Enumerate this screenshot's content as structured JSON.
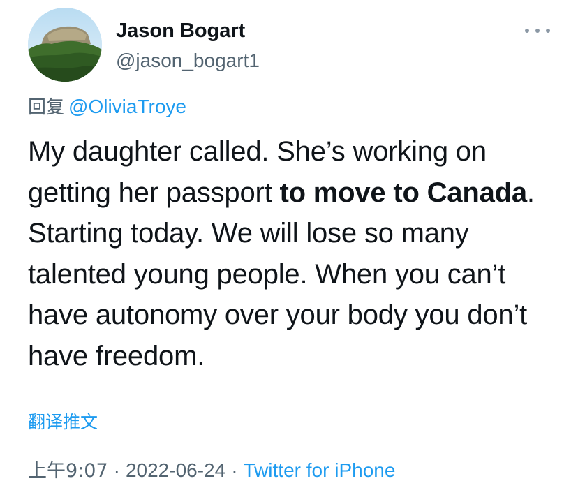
{
  "author": {
    "display_name": "Jason Bogart",
    "handle": "@jason_bogart1"
  },
  "reply": {
    "prefix": "回复",
    "mention": "@OliviaTroye"
  },
  "tweet": {
    "text_part1": "My daughter called. She’s working on getting her passport ",
    "text_bold1": "to move to Canada",
    "text_part2": ". Starting today. We will lose so many talented young people. When you can’t have autonomy over your body you don’t have freedom."
  },
  "translate_label": "翻译推文",
  "meta": {
    "time": "上午9:07",
    "separator": "·",
    "date": "2022-06-24",
    "source": "Twitter for iPhone"
  },
  "colors": {
    "link": "#1d9bf0",
    "secondary_text": "#536471",
    "primary_text": "#0f1419"
  },
  "icons": {
    "more": "more-horizontal-icon"
  }
}
